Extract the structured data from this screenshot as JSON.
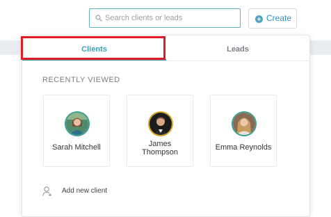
{
  "search": {
    "placeholder": "Search clients or leads",
    "value": ""
  },
  "header": {
    "create_label": "Create"
  },
  "tabs": [
    {
      "label": "Clients",
      "active": true
    },
    {
      "label": "Leads",
      "active": false
    }
  ],
  "recent": {
    "title": "RECENTLY VIEWED",
    "clients": [
      {
        "name": "Sarah Mitchell",
        "avatar_ring": "#3a9e92"
      },
      {
        "name": "James Thompson",
        "avatar_ring": "#d8a21c"
      },
      {
        "name": "Emma Reynolds",
        "avatar_ring": "#3a9e92"
      }
    ]
  },
  "add_client": {
    "label": "Add new client",
    "icon": "add-user-icon"
  },
  "colors": {
    "accent": "#3aa0b6",
    "create_icon": "#4aa6c8",
    "highlight": "#e01b24"
  }
}
